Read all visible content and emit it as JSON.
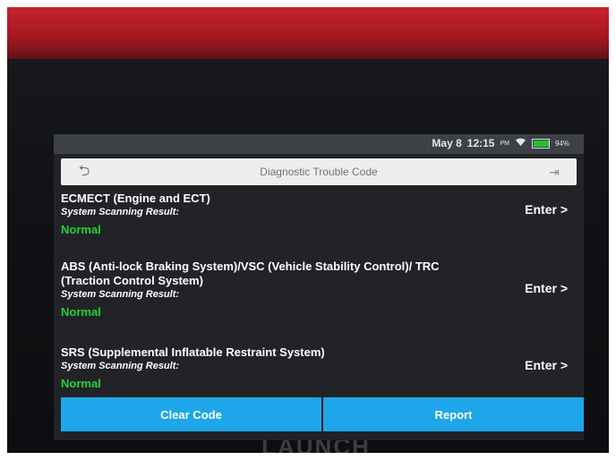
{
  "status_bar": {
    "date": "May 8",
    "time": "12:15",
    "ampm": "PM",
    "wifi_icon": "wifi-icon",
    "battery_percent": "94%",
    "battery_level": 0.94,
    "battery_color": "#23c22f"
  },
  "header": {
    "back_icon": "back-arrow-icon",
    "title": "Diagnostic Trouble Code",
    "exit_icon": "exit-icon"
  },
  "systems": [
    {
      "name": "ECMECT (Engine and ECT)",
      "subtitle": "System Scanning Result:",
      "status": "Normal",
      "action": "Enter >"
    },
    {
      "name": "ABS (Anti-lock Braking System)/VSC (Vehicle Stability Control)/ TRC (Traction Control System)",
      "subtitle": "System Scanning Result:",
      "status": "Normal",
      "action": "Enter >"
    },
    {
      "name": "SRS (Supplemental Inflatable Restraint System)",
      "subtitle": "System Scanning Result:",
      "status": "Normal",
      "action": "Enter >"
    }
  ],
  "footer": {
    "clear_label": "Clear Code",
    "report_label": "Report"
  },
  "colors": {
    "accent": "#1da7ea",
    "status_normal": "#22d13a",
    "device_rim": "#c4222c"
  },
  "device_brand": "LAUNCH"
}
